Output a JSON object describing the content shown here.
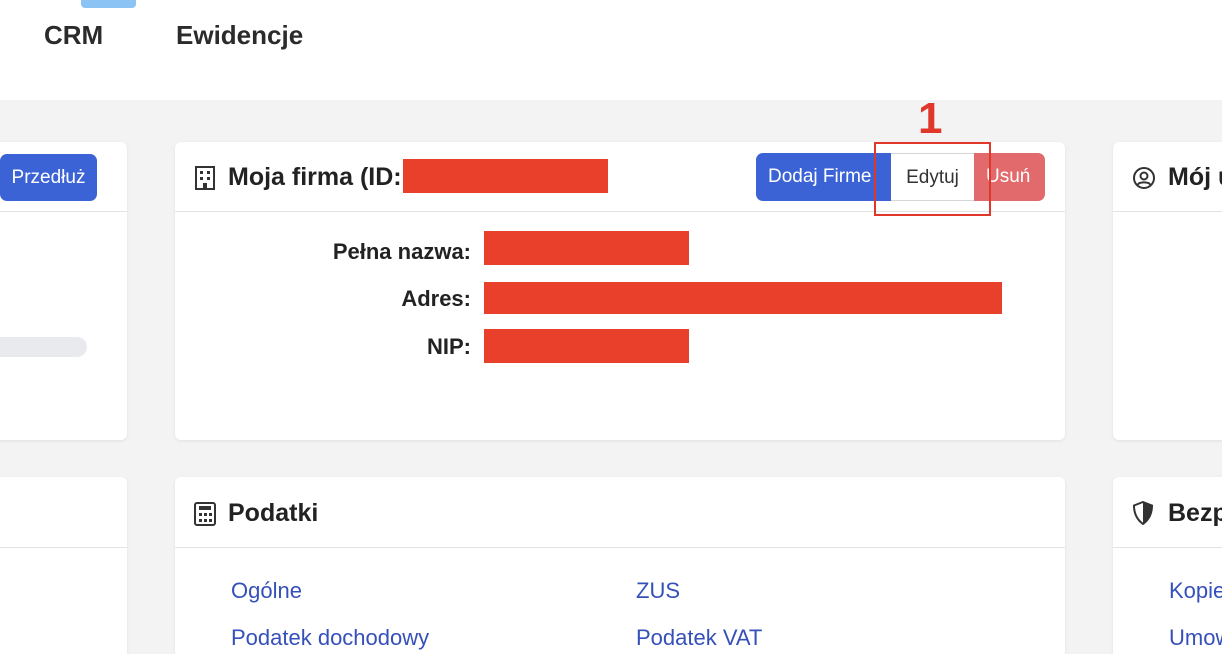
{
  "nav": {
    "items": [
      {
        "label": "CRM"
      },
      {
        "label": "Ewidencje"
      }
    ]
  },
  "left_card": {
    "button_label": "Przedłuż"
  },
  "firm_card": {
    "title": "Moja firma (ID:",
    "buttons": {
      "add": "Dodaj Firme",
      "edit": "Edytuj",
      "delete": "Usuń"
    },
    "fields": [
      {
        "label": "Pełna nazwa:"
      },
      {
        "label": "Adres:"
      },
      {
        "label": "NIP:"
      }
    ],
    "annotation": "1"
  },
  "right_top_card": {
    "title": "Mój u"
  },
  "podatki_card": {
    "title": "Podatki",
    "links": [
      {
        "label": "Ogólne"
      },
      {
        "label": "ZUS"
      },
      {
        "label": "Podatek dochodowy"
      },
      {
        "label": "Podatek VAT"
      }
    ]
  },
  "right_bottom_card": {
    "title": "Bezp",
    "links": [
      {
        "label": "Kopie"
      },
      {
        "label": "Umow"
      }
    ]
  },
  "colors": {
    "primary": "#3b63d6",
    "danger": "#e36a6c",
    "link": "#3550b8",
    "annotation": "#e0372a",
    "redaction": "#e8402a"
  }
}
